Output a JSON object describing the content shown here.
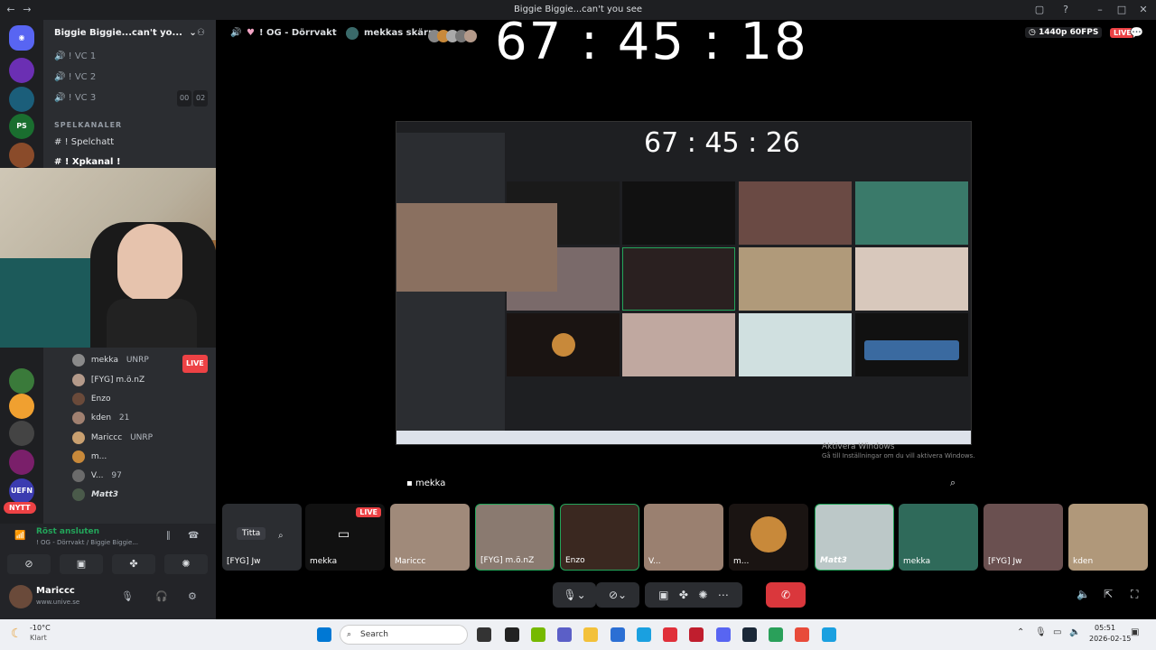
{
  "window": {
    "title": "Biggie Biggie...can't you see"
  },
  "server": {
    "name": "Biggie Biggie...can't yo..."
  },
  "channels": {
    "vc1": "! VC 1",
    "vc2": "! VC 2",
    "vc3": "! VC 3",
    "vc3_count_a": "00",
    "vc3_count_b": "02",
    "category": "SPELKANALER",
    "spelchatt": "! Spelchatt",
    "xpkanal": "! Xpkanal !"
  },
  "voice_users": [
    {
      "name": "mekka",
      "tag": "UNRP",
      "live": "LIVE"
    },
    {
      "name": "[FYG] m.ö.nZ"
    },
    {
      "name": "Enzo"
    },
    {
      "name": "kden",
      "tag": "21"
    },
    {
      "name": "Mariccc",
      "tag": "UNRP"
    },
    {
      "name": "m..."
    },
    {
      "name": "V...",
      "tag": "97"
    },
    {
      "name": "Matt3"
    }
  ],
  "new_badge": "NYTT",
  "voice_panel": {
    "status": "Röst ansluten",
    "channel": "! OG - Dörrvakt / Biggie Biggie...",
    "user": "Mariccc",
    "user_sub": "www.unive.se"
  },
  "stage": {
    "channel": "! OG - Dörrvakt",
    "stream": "mekkas skärm",
    "quality": "1440p 60FPS",
    "live": "LIVE",
    "clock": "67 : 45 : 18",
    "inner_clock": "67 : 45 : 26",
    "activate_windows": "Aktivera Windows",
    "activate_windows_sub": "Gå till Inställningar om du vill aktivera Windows.",
    "speaker_label": "mekka"
  },
  "thumbnails": [
    {
      "label": "[FYG] Jw",
      "top": "Titta"
    },
    {
      "label": "mekka",
      "live": "LIVE"
    },
    {
      "label": "Mariccc"
    },
    {
      "label": "[FYG] m.ö.nZ"
    },
    {
      "label": "Enzo"
    },
    {
      "label": "V..."
    },
    {
      "label": "m..."
    },
    {
      "label": "Matt3"
    },
    {
      "label": "mekka"
    },
    {
      "label": "[FYG] Jw"
    },
    {
      "label": "kden"
    }
  ],
  "taskbar": {
    "weather_temp": "-10°C",
    "weather_desc": "Klart",
    "search": "Search",
    "time": "05:51",
    "date": "2026-02-15"
  },
  "colors": {
    "live": "#ed4245",
    "accent_green": "#23a55a",
    "leave": "#da373c"
  }
}
